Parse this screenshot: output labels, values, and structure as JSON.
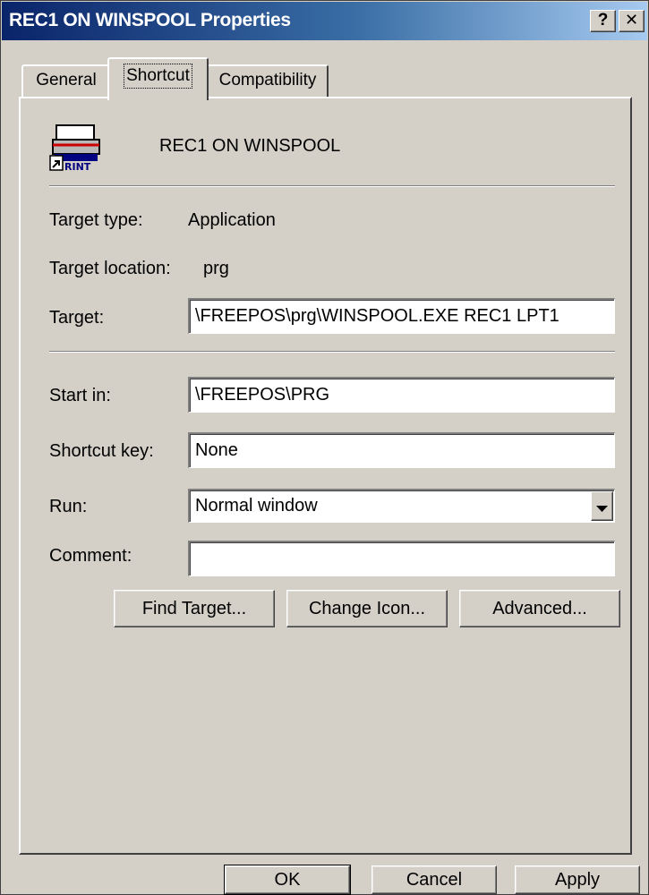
{
  "window": {
    "title": "REC1 ON WINSPOOL Properties",
    "help_symbol": "?",
    "close_symbol": "✕",
    "titlebar_color": "#0a246a"
  },
  "tabs": [
    {
      "label": "General",
      "active": false
    },
    {
      "label": "Shortcut",
      "active": true
    },
    {
      "label": "Compatibility",
      "active": false
    }
  ],
  "shortcut": {
    "name": "REC1 ON WINSPOOL",
    "icon": "printer-shortcut-icon",
    "icon_caption": "RINT",
    "fields": {
      "target_type": {
        "label": "Target type:",
        "value": "Application"
      },
      "target_location": {
        "label": "Target location:",
        "value": "prg"
      },
      "target": {
        "label": "Target:",
        "value": "\\FREEPOS\\prg\\WINSPOOL.EXE REC1 LPT1"
      },
      "start_in": {
        "label": "Start in:",
        "value": "\\FREEPOS\\PRG"
      },
      "shortcut_key": {
        "label": "Shortcut key:",
        "value": "None"
      },
      "run": {
        "label": "Run:",
        "value": "Normal window"
      },
      "comment": {
        "label": "Comment:",
        "value": ""
      }
    },
    "buttons": {
      "find_target": "Find Target...",
      "change_icon": "Change Icon...",
      "advanced": "Advanced..."
    }
  },
  "footer": {
    "ok": "OK",
    "cancel": "Cancel",
    "apply": "Apply"
  }
}
